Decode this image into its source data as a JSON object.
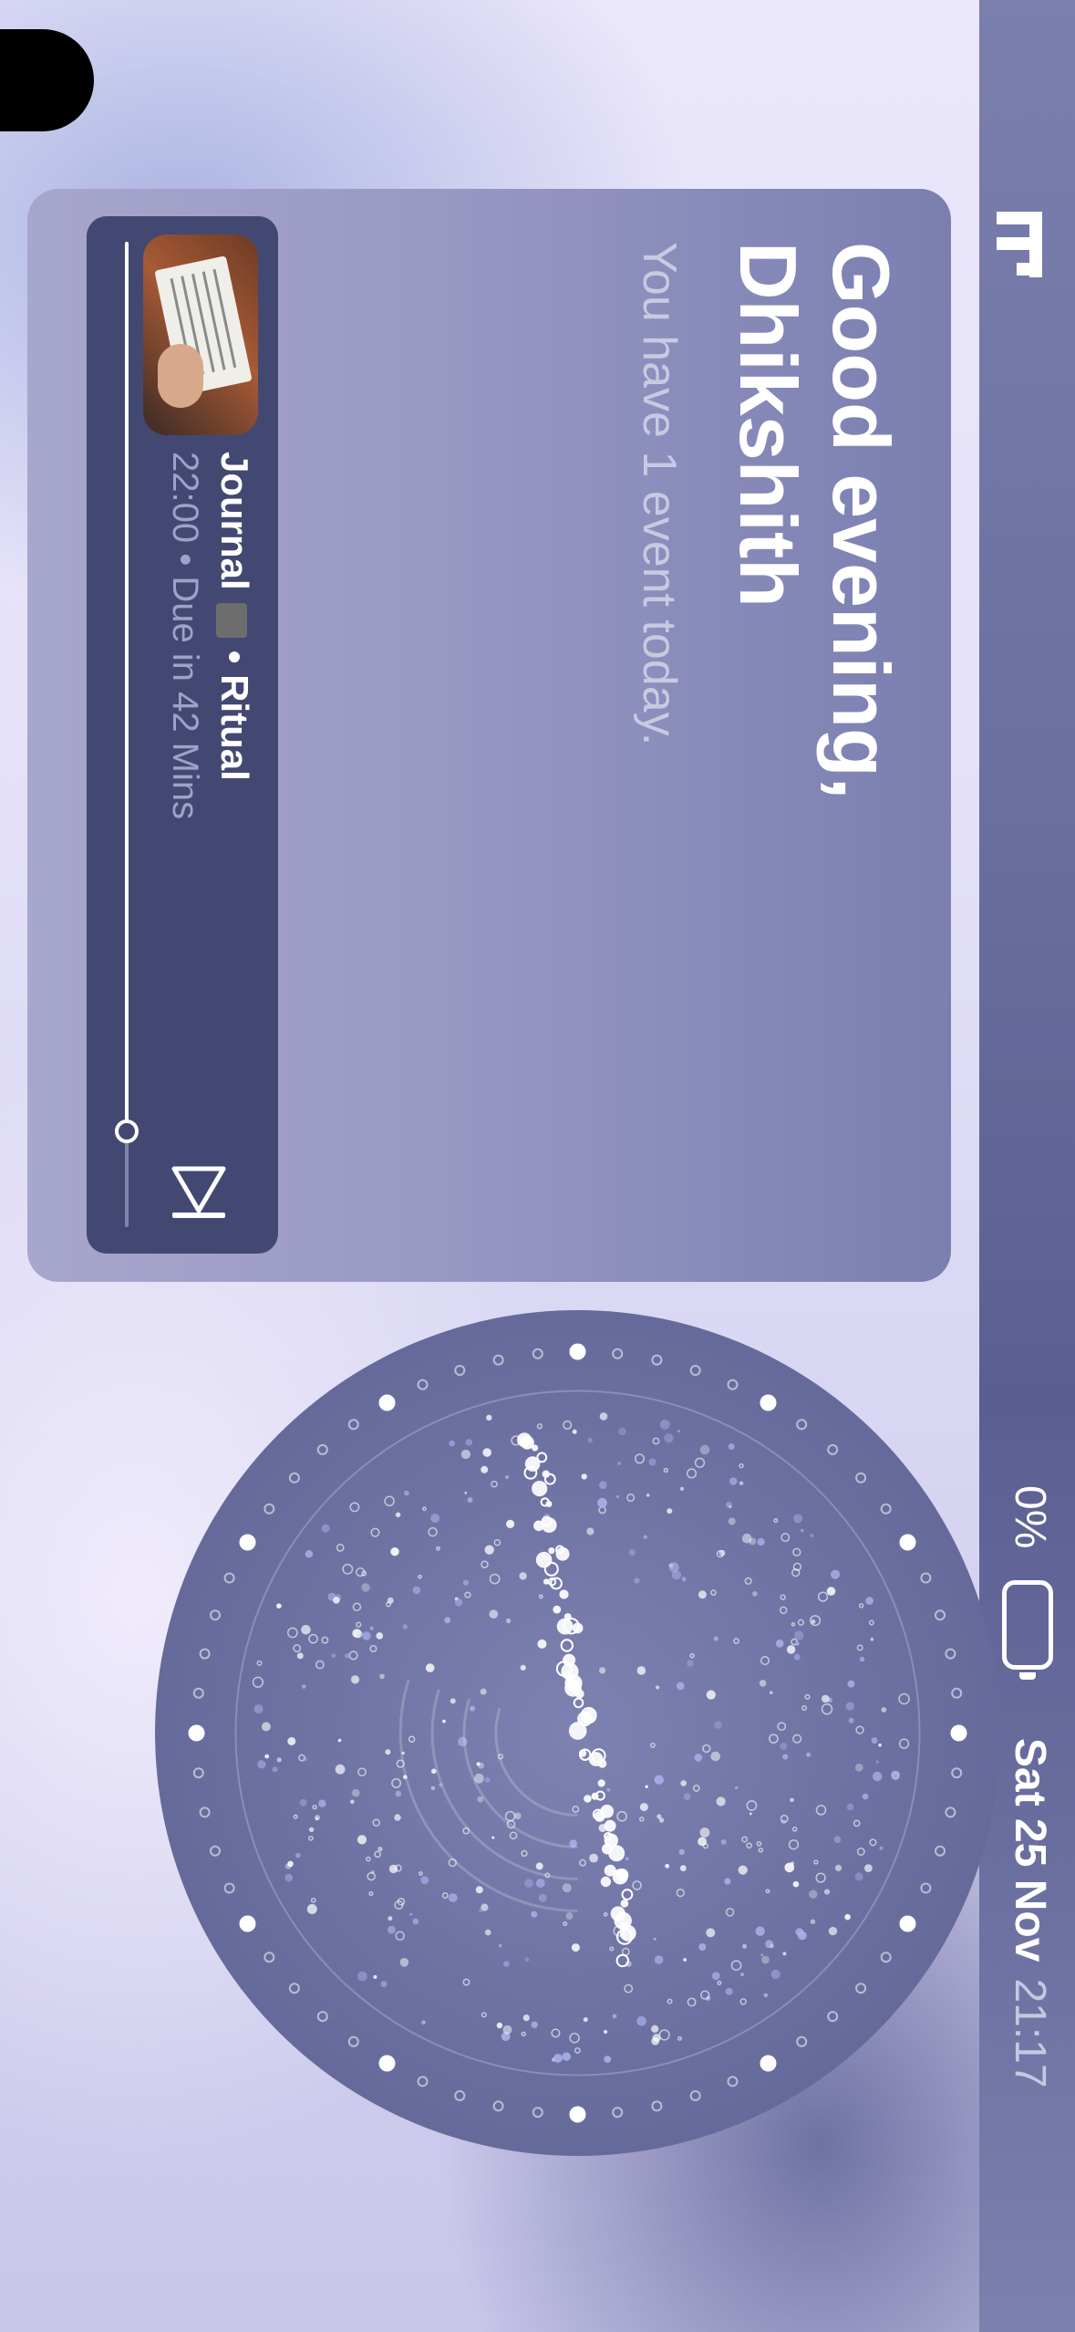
{
  "status_bar": {
    "date": "Sat 25 Nov",
    "time": "21:17",
    "battery_percent": "0%",
    "battery_level": 0
  },
  "greeting": {
    "title_line1": "Good evening,",
    "title_line2": "Dhikshith",
    "subtitle": "You have 1 event today."
  },
  "event": {
    "name": "Journal",
    "emoji_icon": "notebook-icon",
    "separator": "•",
    "category": "Ritual",
    "meta": "22:00 • Due in 42 Mins",
    "progress": 0.9
  },
  "colors": {
    "card_top": "#7a7fb0",
    "event_bg": "#434873",
    "dial_bg": "#6c6f9f",
    "accent": "#ffffff"
  }
}
